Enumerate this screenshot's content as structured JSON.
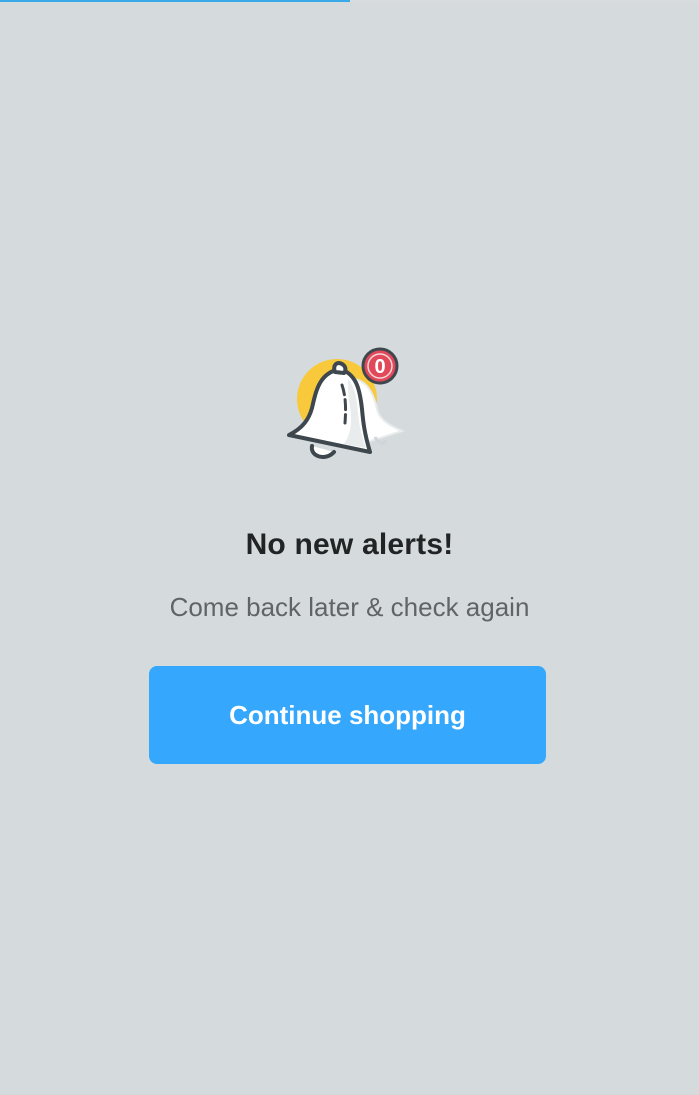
{
  "page": {
    "background_color": "#d5dbdc",
    "loading_progress": 0.5
  },
  "empty_state": {
    "icon": "bell-alert-icon",
    "badge_count": "0",
    "title": "No new alerts!",
    "subtitle": "Come back later & check again",
    "cta_label": "Continue shopping"
  },
  "colors": {
    "accent": "#35a8fd",
    "progress": "#3aa9e8",
    "badge": "#e1495a",
    "bell_highlight": "#f8c93b",
    "title_text": "#212325",
    "subtitle_text": "#606466"
  }
}
